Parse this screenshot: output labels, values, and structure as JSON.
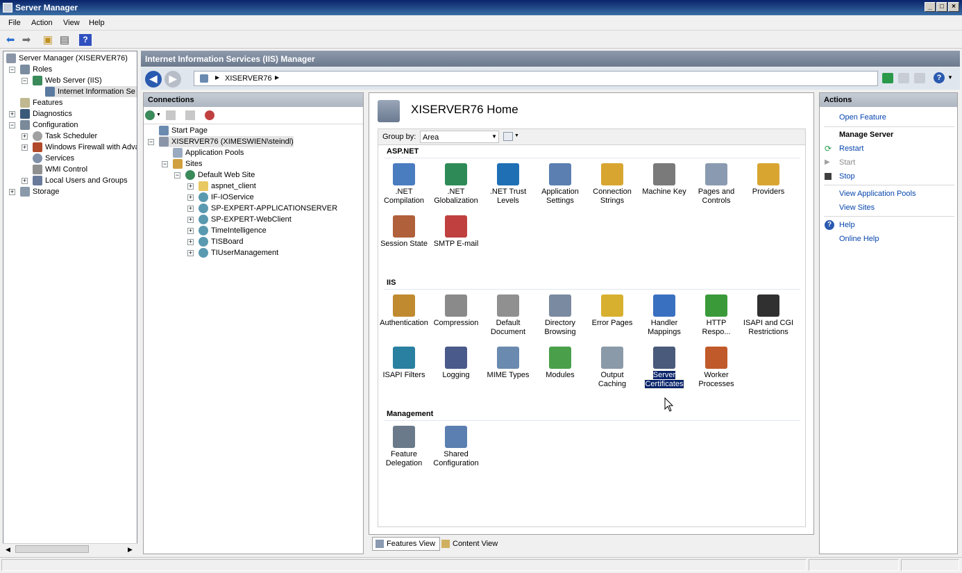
{
  "window": {
    "title": "Server Manager"
  },
  "menu": [
    "File",
    "Action",
    "View",
    "Help"
  ],
  "tree": {
    "root": "Server Manager (XISERVER76)",
    "roles": "Roles",
    "webserver": "Web Server (IIS)",
    "iis": "Internet Information Se",
    "features": "Features",
    "diagnostics": "Diagnostics",
    "configuration": "Configuration",
    "task_scheduler": "Task Scheduler",
    "firewall": "Windows Firewall with Adva",
    "services": "Services",
    "wmi": "WMI Control",
    "local_users": "Local Users and Groups",
    "storage": "Storage"
  },
  "iis": {
    "header": "Internet Information Services (IIS) Manager",
    "address_crumb": "XISERVER76"
  },
  "connections": {
    "title": "Connections",
    "start_page": "Start Page",
    "server": "XISERVER76 (XIMESWIEN\\steindl)",
    "app_pools": "Application Pools",
    "sites": "Sites",
    "default_site": "Default Web Site",
    "children": [
      "aspnet_client",
      "IF-IOService",
      "SP-EXPERT-APPLICATIONSERVER",
      "SP-EXPERT-WebClient",
      "TimeIntelligence",
      "TISBoard",
      "TIUserManagement"
    ]
  },
  "home": {
    "title": "XISERVER76 Home",
    "group_by_label": "Group by:",
    "group_by_value": "Area",
    "sections": {
      "aspnet": "ASP.NET",
      "iis": "IIS",
      "management": "Management"
    },
    "aspnet": [
      {
        "l1": ".NET",
        "l2": "Compilation",
        "icon": "net-compilation-icon",
        "color": "#4a7cc0"
      },
      {
        "l1": ".NET",
        "l2": "Globalization",
        "icon": "net-globalization-icon",
        "color": "#2e8b57"
      },
      {
        "l1": ".NET Trust",
        "l2": "Levels",
        "icon": "net-trust-levels-icon",
        "color": "#1f6fb5"
      },
      {
        "l1": "Application",
        "l2": "Settings",
        "icon": "application-settings-icon",
        "color": "#5a7fb0"
      },
      {
        "l1": "Connection",
        "l2": "Strings",
        "icon": "connection-strings-icon",
        "color": "#d8a630"
      },
      {
        "l1": "Machine Key",
        "l2": "",
        "icon": "machine-key-icon",
        "color": "#7a7a7a"
      },
      {
        "l1": "Pages and",
        "l2": "Controls",
        "icon": "pages-controls-icon",
        "color": "#8a9ab0"
      },
      {
        "l1": "Providers",
        "l2": "",
        "icon": "providers-icon",
        "color": "#d8a630"
      },
      {
        "l1": "Session State",
        "l2": "",
        "icon": "session-state-icon",
        "color": "#b0603a"
      },
      {
        "l1": "SMTP E-mail",
        "l2": "",
        "icon": "smtp-email-icon",
        "color": "#c04040"
      }
    ],
    "iisf": [
      {
        "l1": "Authentication",
        "l2": "",
        "icon": "authentication-icon",
        "color": "#c08a30"
      },
      {
        "l1": "Compression",
        "l2": "",
        "icon": "compression-icon",
        "color": "#8a8a8a"
      },
      {
        "l1": "Default",
        "l2": "Document",
        "icon": "default-document-icon",
        "color": "#909090"
      },
      {
        "l1": "Directory",
        "l2": "Browsing",
        "icon": "directory-browsing-icon",
        "color": "#7a8aa0"
      },
      {
        "l1": "Error Pages",
        "l2": "",
        "icon": "error-pages-icon",
        "color": "#d8b030"
      },
      {
        "l1": "Handler",
        "l2": "Mappings",
        "icon": "handler-mappings-icon",
        "color": "#3a70c0"
      },
      {
        "l1": "HTTP",
        "l2": "Respo...",
        "icon": "http-response-icon",
        "color": "#3a9a3a"
      },
      {
        "l1": "ISAPI and CGI",
        "l2": "Restrictions",
        "icon": "isapi-cgi-icon",
        "color": "#303030"
      },
      {
        "l1": "ISAPI Filters",
        "l2": "",
        "icon": "isapi-filters-icon",
        "color": "#2a80a0"
      },
      {
        "l1": "Logging",
        "l2": "",
        "icon": "logging-icon",
        "color": "#4a5a8a"
      },
      {
        "l1": "MIME Types",
        "l2": "",
        "icon": "mime-types-icon",
        "color": "#6a8ab0"
      },
      {
        "l1": "Modules",
        "l2": "",
        "icon": "modules-icon",
        "color": "#4aa04a"
      },
      {
        "l1": "Output",
        "l2": "Caching",
        "icon": "output-caching-icon",
        "color": "#8a9aa8"
      },
      {
        "l1": "Server",
        "l2": "Certificates",
        "icon": "server-certificates-icon",
        "color": "#4a5a7a"
      },
      {
        "l1": "Worker",
        "l2": "Processes",
        "icon": "worker-processes-icon",
        "color": "#c05a2a"
      }
    ],
    "management": [
      {
        "l1": "Feature",
        "l2": "Delegation",
        "icon": "feature-delegation-icon",
        "color": "#6a7a8a"
      },
      {
        "l1": "Shared",
        "l2": "Configuration",
        "icon": "shared-configuration-icon",
        "color": "#5a7fb0"
      }
    ]
  },
  "viewtabs": {
    "features": "Features View",
    "content": "Content View"
  },
  "actions": {
    "title": "Actions",
    "open_feature": "Open Feature",
    "manage_server": "Manage Server",
    "restart": "Restart",
    "start": "Start",
    "stop": "Stop",
    "view_app_pools": "View Application Pools",
    "view_sites": "View Sites",
    "help": "Help",
    "online_help": "Online Help"
  }
}
